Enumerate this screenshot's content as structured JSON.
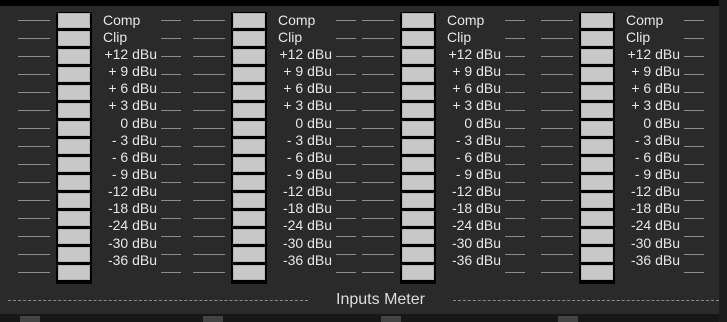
{
  "meter_panel": {
    "title": "Inputs Meter",
    "channels": [
      {
        "labels": [
          "Comp",
          "Clip",
          "+12 dBu",
          "+ 9 dBu",
          "+ 6 dBu",
          "+ 3 dBu",
          "0 dBu",
          "- 3 dBu",
          "- 6 dBu",
          "- 9 dBu",
          "-12 dBu",
          "-18 dBu",
          "-24 dBu",
          "-30 dBu",
          "-36 dBu"
        ]
      },
      {
        "labels": [
          "Comp",
          "Clip",
          "+12 dBu",
          "+ 9 dBu",
          "+ 6 dBu",
          "+ 3 dBu",
          "0 dBu",
          "- 3 dBu",
          "- 6 dBu",
          "- 9 dBu",
          "-12 dBu",
          "-18 dBu",
          "-24 dBu",
          "-30 dBu",
          "-36 dBu"
        ]
      },
      {
        "labels": [
          "Comp",
          "Clip",
          "+12 dBu",
          "+ 9 dBu",
          "+ 6 dBu",
          "+ 3 dBu",
          "0 dBu",
          "- 3 dBu",
          "- 6 dBu",
          "- 9 dBu",
          "-12 dBu",
          "-18 dBu",
          "-24 dBu",
          "-30 dBu",
          "-36 dBu"
        ]
      },
      {
        "labels": [
          "Comp",
          "Clip",
          "+12 dBu",
          "+ 9 dBu",
          "+ 6 dBu",
          "+ 3 dBu",
          "0 dBu",
          "- 3 dBu",
          "- 6 dBu",
          "- 9 dBu",
          "-12 dBu",
          "-18 dBu",
          "-24 dBu",
          "-30 dBu",
          "-36 dBu"
        ]
      }
    ]
  },
  "colors": {
    "panel_bg": "#2a2a2a",
    "segment": "#c8c8c8",
    "tick": "#8d8d8d",
    "text": "#e6e6e6"
  }
}
